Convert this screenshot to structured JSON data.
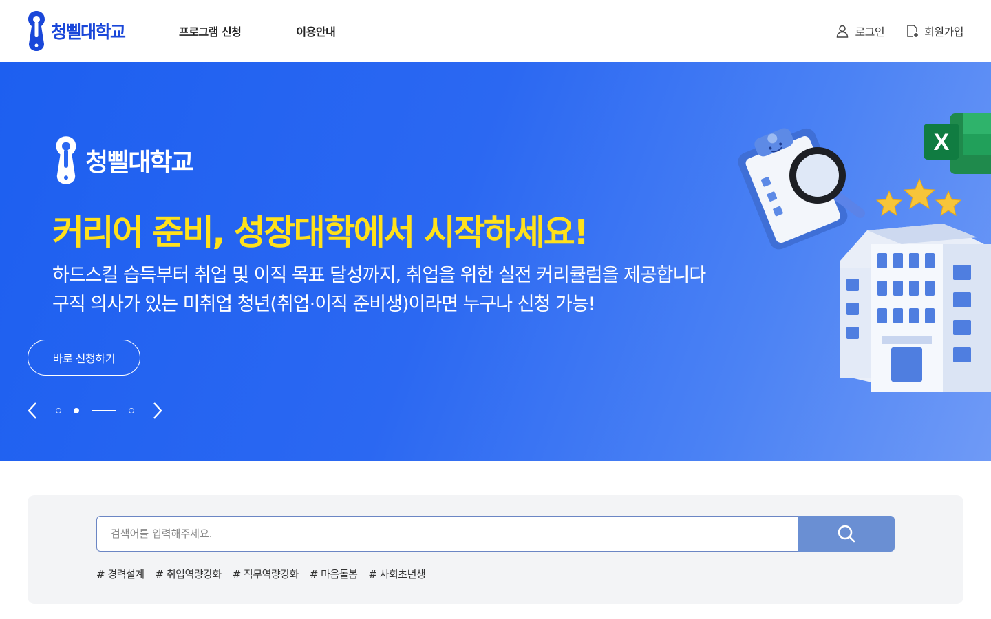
{
  "header": {
    "logo_text": "청삘대학교",
    "nav": [
      "프로그램 신청",
      "이용안내"
    ],
    "login_label": "로그인",
    "signup_label": "회원가입",
    "icons": {
      "login": "user-icon",
      "signup": "document-add-icon"
    }
  },
  "hero": {
    "logo_text": "청삘대학교",
    "title": "커리어 준비, 성장대학에서 시작하세요!",
    "desc_line1": "하드스킬 습득부터 취업 및 이직 목표 달성까지, 취업을 위한 실전 커리큘럼을 제공합니다",
    "desc_line2": "구직 의사가 있는 미취업 청년(취업·이직 준비생)이라면 누구나 신청 가능!",
    "cta_label": "바로 신청하기",
    "slider": {
      "slide_count": 4,
      "active_index": 2
    },
    "excel_letter": "X",
    "colors": {
      "background": "#2b68f2",
      "title": "#ffe11b"
    }
  },
  "search": {
    "placeholder": "검색어를 입력해주세요.",
    "value": "",
    "button_icon": "search-icon",
    "tags": [
      "# 경력설계",
      "# 취업역량강화",
      "# 직무역량강화",
      "# 마음돌봄",
      "# 사회초년생"
    ]
  }
}
